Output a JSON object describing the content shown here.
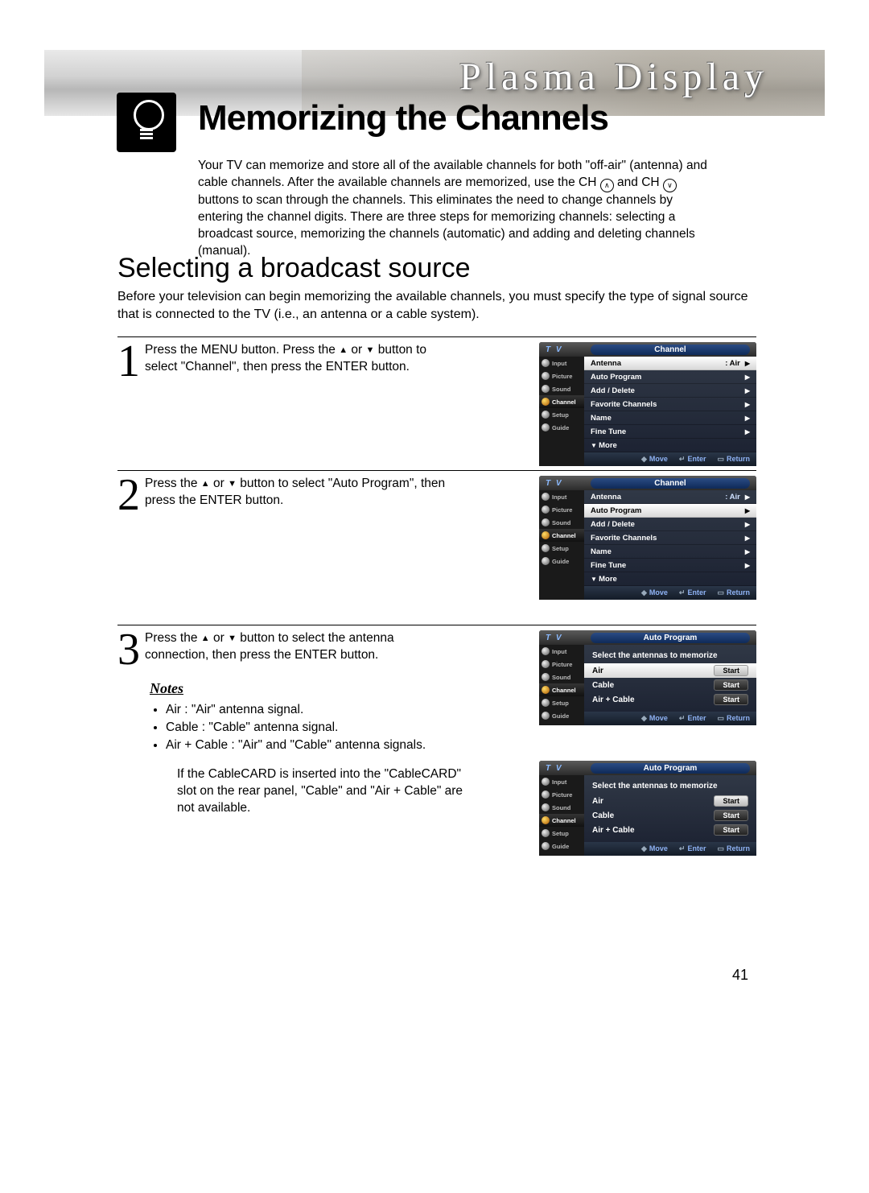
{
  "banner": {
    "title": "Plasma Display"
  },
  "main_title": "Memorizing the Channels",
  "intro": {
    "p1a": "Your TV can memorize and store all of the available channels for both \"off-air\" (antenna) and cable channels. After the available channels are memorized, use the CH ",
    "p1b": " and CH ",
    "p1c": " buttons to scan through the channels. This eliminates the need to change channels by entering the channel digits. There are three steps for memorizing channels: selecting a broadcast source, memorizing the channels (automatic) and adding and deleting channels (manual)."
  },
  "section": {
    "heading": "Selecting a broadcast source",
    "intro": "Before your television can begin memorizing the available channels, you must specify the type of signal source that is connected to the TV (i.e., an antenna or a cable system)."
  },
  "steps": {
    "s1": {
      "num": "1",
      "a": "Press the MENU button. Press the ",
      "b": " or ",
      "c": " button to select \"Channel\", then press the ENTER button."
    },
    "s2": {
      "num": "2",
      "a": "Press the ",
      "b": " or ",
      "c": " button to select \"Auto Program\", then press the ENTER button."
    },
    "s3": {
      "num": "3",
      "a": "Press the ",
      "b": " or ",
      "c": " button to select the antenna connection, then press the ENTER button."
    }
  },
  "notes": {
    "heading": "Notes",
    "n1": "Air : \"Air\" antenna signal.",
    "n2": "Cable : \"Cable\" antenna signal.",
    "n3": "Air + Cable : \"Air\" and \"Cable\" antenna signals.",
    "follow": "If the CableCARD is inserted into the \"CableCARD\" slot on the rear panel, \"Cable\" and \"Air + Cable\" are not available."
  },
  "osd": {
    "tv": "T V",
    "side": {
      "input": "Input",
      "picture": "Picture",
      "sound": "Sound",
      "channel": "Channel",
      "setup": "Setup",
      "guide": "Guide"
    },
    "channel_title": "Channel",
    "rows": {
      "antenna": {
        "label": "Antenna",
        "val": ": Air"
      },
      "auto_program": "Auto Program",
      "add_delete": "Add / Delete",
      "favorite": "Favorite Channels",
      "name": "Name",
      "fine": "Fine Tune",
      "more": "More"
    },
    "footer": {
      "move": "Move",
      "enter": "Enter",
      "return": "Return"
    },
    "ap": {
      "title": "Auto Program",
      "instr": "Select the antennas to memorize",
      "air": "Air",
      "cable": "Cable",
      "aircable": "Air + Cable",
      "start": "Start"
    }
  },
  "page_number": "41"
}
